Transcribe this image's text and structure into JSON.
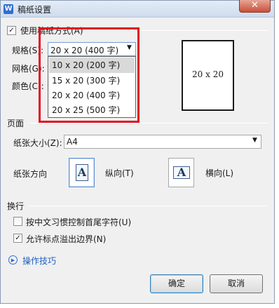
{
  "window": {
    "title": "稿纸设置",
    "app_icon": "W",
    "close_glyph": "✕"
  },
  "grid_section": {
    "use_grid_checkbox": {
      "label": "使用稿纸方式(A)",
      "checked": true,
      "check_glyph": "✓"
    },
    "spec_label": "规格(S):",
    "grid_label": "网格(G):",
    "color_label": "颜色(C):",
    "spec_combo": {
      "value": "20 x 20 (400 字)",
      "arrow": "▼"
    },
    "spec_options": [
      {
        "label": "10 x 20 (200 字)",
        "highlighted": true
      },
      {
        "label": "15 x 20 (300 字)",
        "highlighted": false
      },
      {
        "label": "20 x 20 (400 字)",
        "highlighted": false
      },
      {
        "label": "20 x 25 (500 字)",
        "highlighted": false
      }
    ],
    "preview_text": "20 x 20",
    "highlight_color": "#e0101e"
  },
  "page_section": {
    "heading": "页面",
    "paper_size_label": "纸张大小(Z):",
    "paper_size_value": "A4",
    "paper_size_arrow": "▼",
    "orientation_label": "纸张方向",
    "portrait": {
      "label": "纵向(T)",
      "glyph": "A",
      "selected": true
    },
    "landscape": {
      "label": "横向(L)",
      "glyph": "A",
      "selected": false
    }
  },
  "line_break_section": {
    "heading": "换行",
    "control_first_last_chars": {
      "label": "按中文习惯控制首尾字符(U)",
      "checked": false
    },
    "allow_punctuation_overflow": {
      "label": "允许标点溢出边界(N)",
      "checked": true,
      "check_glyph": "✓"
    }
  },
  "tips": {
    "label": "操作技巧",
    "icon_glyph": "▶"
  },
  "buttons": {
    "ok": "确定",
    "cancel": "取消"
  }
}
